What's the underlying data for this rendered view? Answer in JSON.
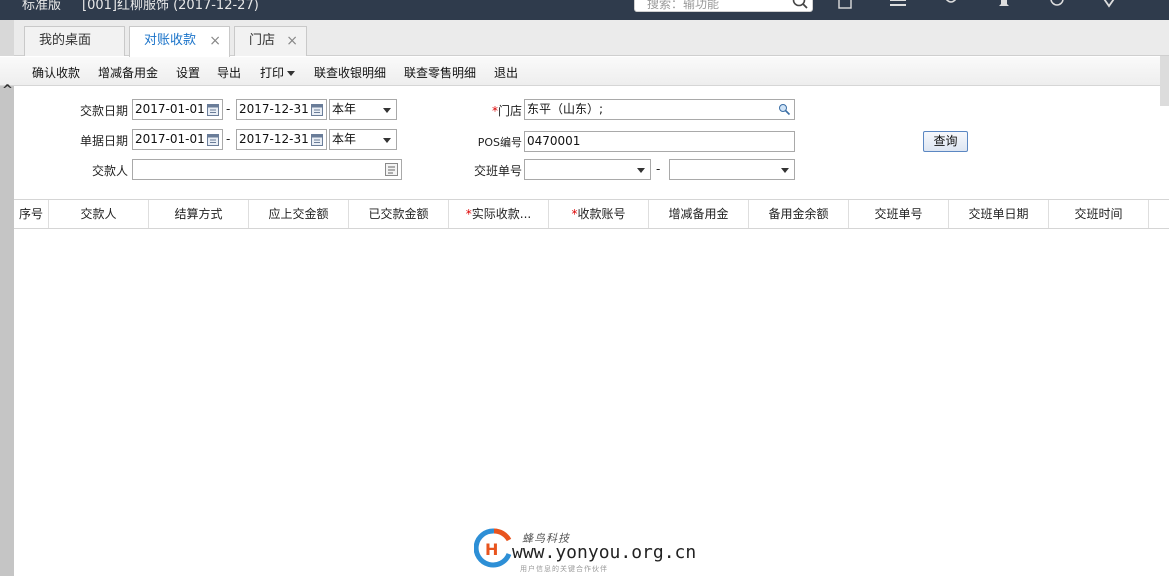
{
  "header": {
    "edition": "标准版",
    "company": "[001]红柳服饰  (2017-12-27)",
    "search_placeholder": "搜索：输功能"
  },
  "tabs": [
    {
      "label": "我的桌面",
      "closable": false,
      "active": false
    },
    {
      "label": "对账收款",
      "closable": true,
      "active": true
    },
    {
      "label": "门店",
      "closable": true,
      "active": false
    }
  ],
  "toolbar": {
    "confirm": "确认收款",
    "adjust": "增减备用金",
    "settings": "设置",
    "export": "导出",
    "print": "打印",
    "link_cash": "联查收银明细",
    "link_retail": "联查零售明细",
    "exit": "退出"
  },
  "form": {
    "pay_date_label": "交款日期",
    "pay_date_from": "2017-01-01",
    "pay_date_to": "2017-12-31",
    "pay_date_range": "本年",
    "doc_date_label": "单据日期",
    "doc_date_from": "2017-01-01",
    "doc_date_to": "2017-12-31",
    "doc_date_range": "本年",
    "payer_label": "交款人",
    "payer_value": "",
    "store_required": "*",
    "store_label": "门店",
    "store_value": "东平（山东）;",
    "pos_label": "POS编号",
    "pos_value": "0470001",
    "shift_label": "交班单号",
    "shift_from": "",
    "shift_to": "",
    "dash": "-",
    "query_button": "查询"
  },
  "grid": {
    "columns": [
      {
        "label": "序号",
        "required": false
      },
      {
        "label": "交款人",
        "required": false
      },
      {
        "label": "结算方式",
        "required": false
      },
      {
        "label": "应上交金额",
        "required": false
      },
      {
        "label": "已交款金额",
        "required": false
      },
      {
        "label": "实际收款...",
        "required": true
      },
      {
        "label": "收款账号",
        "required": true
      },
      {
        "label": "增减备用金",
        "required": false
      },
      {
        "label": "备用金余额",
        "required": false
      },
      {
        "label": "交班单号",
        "required": false
      },
      {
        "label": "交班单日期",
        "required": false
      },
      {
        "label": "交班时间",
        "required": false
      }
    ],
    "rows": []
  },
  "watermark": {
    "brand_cn": "蜂鸟科技",
    "url": "www.yonyou.org.cn",
    "sub": "用户信息的关键合作伙伴"
  },
  "colors": {
    "header_bg": "#2f3b4c",
    "active_tab_text": "#1a73c9",
    "required_mark": "#dd0000"
  }
}
